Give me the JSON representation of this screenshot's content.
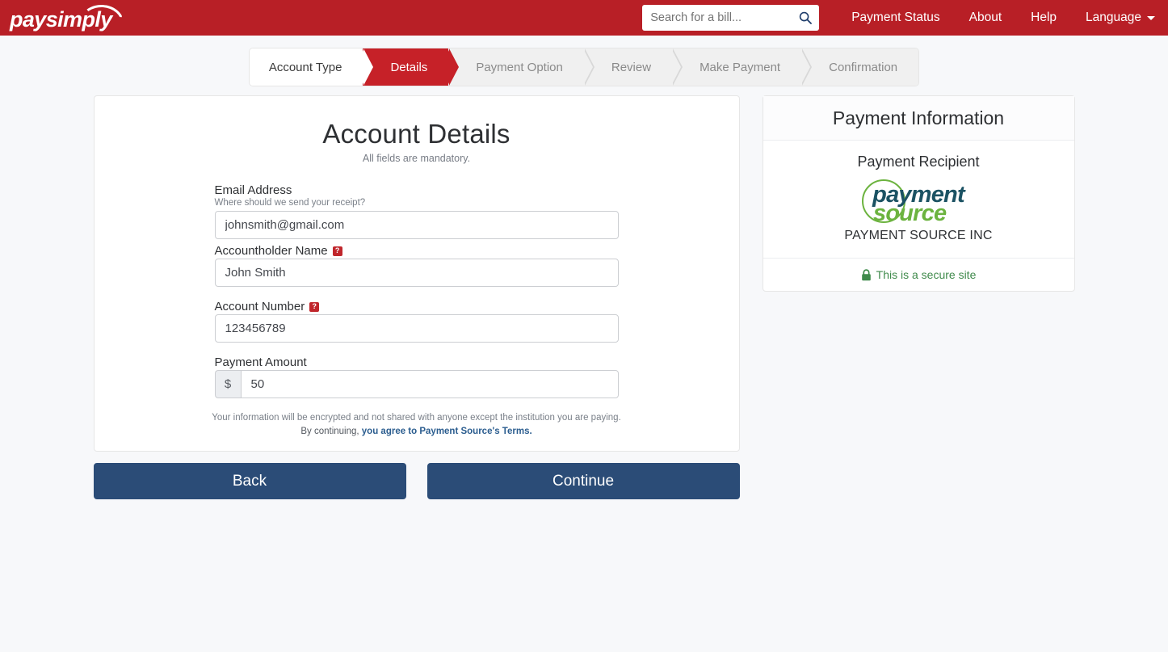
{
  "header": {
    "logo_text": "paysimply",
    "search": {
      "placeholder": "Search for a bill...",
      "value": "",
      "icon": "search-icon"
    },
    "nav": [
      {
        "label": "Payment Status"
      },
      {
        "label": "About"
      },
      {
        "label": "Help"
      },
      {
        "label": "Language",
        "caret": true
      }
    ],
    "brand_color": "#b81f26"
  },
  "steps": [
    {
      "label": "Account Type",
      "state": "done"
    },
    {
      "label": "Details",
      "state": "active"
    },
    {
      "label": "Payment Option",
      "state": "todo"
    },
    {
      "label": "Review",
      "state": "todo"
    },
    {
      "label": "Make Payment",
      "state": "todo"
    },
    {
      "label": "Confirmation",
      "state": "todo"
    }
  ],
  "form": {
    "title": "Account Details",
    "subtitle": "All fields are mandatory.",
    "fields": [
      {
        "label": "Email Address",
        "help_text": "Where should we send your receipt?",
        "value": "johnsmith@gmail.com",
        "placeholder": "",
        "badge": ""
      },
      {
        "label": "Accountholder Name",
        "help_text": "",
        "value": "John Smith",
        "placeholder": "",
        "badge": "?"
      },
      {
        "label": "Account Number",
        "help_text": "",
        "value": "123456789",
        "placeholder": "",
        "badge": "?"
      }
    ],
    "amount": {
      "label": "Payment Amount",
      "currency_symbol": "$",
      "value": "50",
      "placeholder": ""
    },
    "disclaimer": "Your information will be encrypted and not shared with anyone except the institution you are paying.",
    "terms_prefix": "By continuing, ",
    "terms_link": "you agree to Payment Source's Terms.",
    "terms_link_color": "#2b5d8f"
  },
  "buttons": {
    "back": "Back",
    "continue": "Continue",
    "color": "#2b4c77"
  },
  "panel": {
    "heading": "Payment Information",
    "recipient_label": "Payment Recipient",
    "logo_word1": "payment",
    "logo_word2": "source",
    "logo_color1": "#1b5263",
    "logo_color2": "#6cb33f",
    "recipient_name": "PAYMENT SOURCE INC",
    "secure_text": "This is a secure site",
    "secure_color": "#3f8a4b"
  }
}
